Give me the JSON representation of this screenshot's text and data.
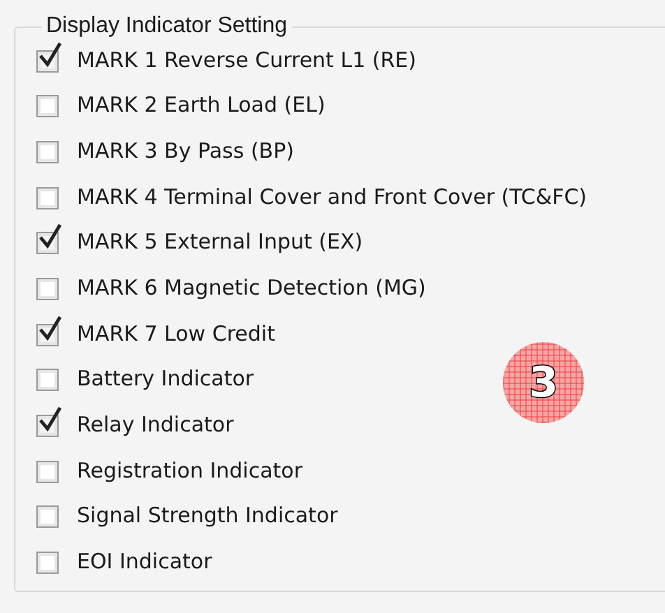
{
  "group": {
    "title": "Display Indicator Setting"
  },
  "options": [
    {
      "label": "MARK 1 Reverse Current L1 (RE)",
      "checked": true
    },
    {
      "label": "MARK 2 Earth Load (EL)",
      "checked": false
    },
    {
      "label": "MARK 3 By Pass (BP)",
      "checked": false
    },
    {
      "label": "MARK 4 Terminal Cover and Front Cover (TC&FC)",
      "checked": false
    },
    {
      "label": "MARK 5 External Input (EX)",
      "checked": true
    },
    {
      "label": "MARK 6 Magnetic Detection (MG)",
      "checked": false
    },
    {
      "label": "MARK 7 Low Credit",
      "checked": true
    },
    {
      "label": "Battery Indicator",
      "checked": false
    },
    {
      "label": "Relay Indicator",
      "checked": true
    },
    {
      "label": "Registration Indicator",
      "checked": false
    },
    {
      "label": "Signal Strength Indicator",
      "checked": false
    },
    {
      "label": "EOI Indicator",
      "checked": false
    }
  ],
  "callout": {
    "number": "3"
  }
}
